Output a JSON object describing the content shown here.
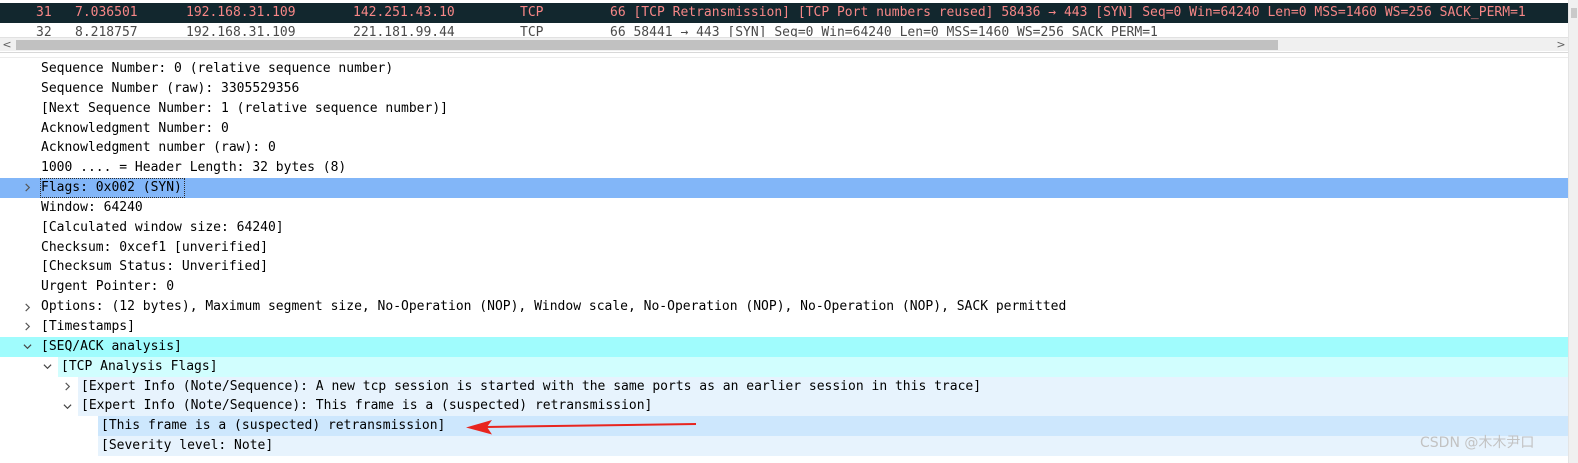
{
  "packet_list": {
    "rows": [
      {
        "no": "31",
        "time": "7.036501",
        "src": "192.168.31.109",
        "dst": "142.251.43.10",
        "proto": "TCP",
        "info": "66 [TCP Retransmission] [TCP Port numbers reused] 58436 → 443 [SYN] Seq=0 Win=64240 Len=0 MSS=1460 WS=256 SACK_PERM=1",
        "selected": true,
        "text_color": "#f78787",
        "bg_color": "#12272e"
      },
      {
        "no": "32",
        "time": "8.218757",
        "src": "192.168.31.109",
        "dst": "221.181.99.44",
        "proto": "TCP",
        "info": "66 58441 → 443 [SYN] Seq=0 Win=64240 Len=0 MSS=1460 WS=256 SACK_PERM=1",
        "selected": false
      }
    ]
  },
  "scrollbar": {
    "left_arrow": "<",
    "right_arrow": ">"
  },
  "details": {
    "rows": [
      {
        "text": "Sequence Number: 0    (relative sequence number)"
      },
      {
        "text": "Sequence Number (raw): 3305529356"
      },
      {
        "text": "[Next Sequence Number: 1    (relative sequence number)]"
      },
      {
        "text": "Acknowledgment Number: 0"
      },
      {
        "text": "Acknowledgment number (raw): 0"
      },
      {
        "text": "1000 .... = Header Length: 32 bytes (8)"
      },
      {
        "text": "Flags: 0x002 (SYN)",
        "expander": "collapsed",
        "highlight": "#82b6f8"
      },
      {
        "text": "Window: 64240"
      },
      {
        "text": "[Calculated window size: 64240]"
      },
      {
        "text": "Checksum: 0xcef1 [unverified]"
      },
      {
        "text": "[Checksum Status: Unverified]"
      },
      {
        "text": "Urgent Pointer: 0"
      },
      {
        "text": "Options: (12 bytes), Maximum segment size, No-Operation (NOP), Window scale, No-Operation (NOP), No-Operation (NOP), SACK permitted",
        "expander": "collapsed"
      },
      {
        "text": "[Timestamps]",
        "expander": "collapsed"
      },
      {
        "text": "[SEQ/ACK analysis]",
        "expander": "expanded",
        "highlight": "#a0fcfd"
      },
      {
        "text": "[TCP Analysis Flags]",
        "expander": "expanded",
        "highlight": "#d1fefe"
      },
      {
        "text": "[Expert Info (Note/Sequence): A new tcp session is started with the same ports as an earlier session in this trace]",
        "expander": "collapsed",
        "highlight": "#e7f3fd"
      },
      {
        "text": "[Expert Info (Note/Sequence): This frame is a (suspected) retransmission]",
        "expander": "expanded",
        "highlight": "#e7f3fd"
      },
      {
        "text": "[This frame is a (suspected) retransmission]",
        "highlight": "#cde7fd"
      },
      {
        "text": "[Severity level: Note]",
        "highlight": "#e7f3fd"
      }
    ]
  },
  "annotation": {
    "color": "#e8251f"
  },
  "watermark": "CSDN @木木尹口"
}
